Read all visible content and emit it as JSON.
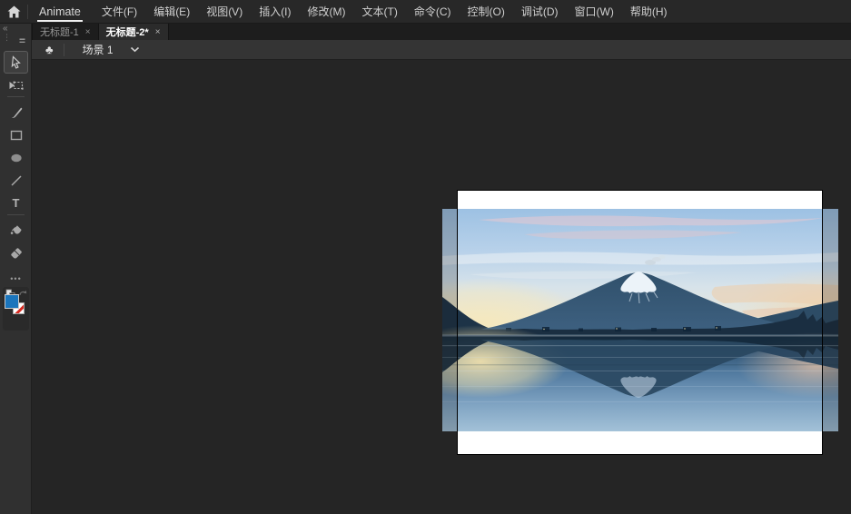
{
  "app": {
    "title": "Animate"
  },
  "menubar": {
    "items": [
      {
        "id": "file",
        "label": "文件(F)"
      },
      {
        "id": "edit",
        "label": "编辑(E)"
      },
      {
        "id": "view",
        "label": "视图(V)"
      },
      {
        "id": "insert",
        "label": "插入(I)"
      },
      {
        "id": "modify",
        "label": "修改(M)"
      },
      {
        "id": "text",
        "label": "文本(T)"
      },
      {
        "id": "command",
        "label": "命令(C)"
      },
      {
        "id": "control",
        "label": "控制(O)"
      },
      {
        "id": "debug",
        "label": "调试(D)"
      },
      {
        "id": "window",
        "label": "窗口(W)"
      },
      {
        "id": "help",
        "label": "帮助(H)"
      }
    ]
  },
  "tabbar": {
    "collapse_icon": "«",
    "grip_icon": "⋮",
    "panel_menu_icon": "=",
    "tabs": [
      {
        "label": "无标题-1",
        "close": "×",
        "active": false
      },
      {
        "label": "无标题-2*",
        "close": "×",
        "active": true
      }
    ]
  },
  "editbar": {
    "scene_icon": "♣",
    "scene_label": "场景 1",
    "dropdown_icon": "chevron-down"
  },
  "toolbar": {
    "tools": [
      {
        "name": "selection-tool",
        "active": true
      },
      {
        "name": "free-transform-tool",
        "active": false
      },
      {
        "name": "brush-tool",
        "active": false
      },
      {
        "name": "rectangle-tool",
        "active": false
      },
      {
        "name": "oval-tool",
        "active": false
      },
      {
        "name": "line-tool",
        "active": false
      },
      {
        "name": "text-tool",
        "active": false,
        "glyph": "T"
      },
      {
        "name": "paint-bucket-tool",
        "active": false
      },
      {
        "name": "eraser-tool",
        "active": false
      },
      {
        "name": "more-tools",
        "active": false,
        "glyph": "•••"
      }
    ],
    "swap_colors_icon": "swap-squares",
    "fill_color": "#1b75bc",
    "stroke_color": "none"
  },
  "canvas": {
    "image_alt": "Photo of snow-capped Mount Fuji reflected in a calm lake at dusk, wider than the white stage"
  },
  "colors": {
    "menubar": "#282828",
    "tabbar": "#1d1d1d",
    "editbar": "#343434",
    "toolbar": "#303030",
    "pasteboard": "#252525",
    "stage": "#ffffff",
    "accent_underline": "#f0f0f0",
    "fill_swatch": "#1b75bc",
    "no_stroke_red": "#d62a20"
  }
}
